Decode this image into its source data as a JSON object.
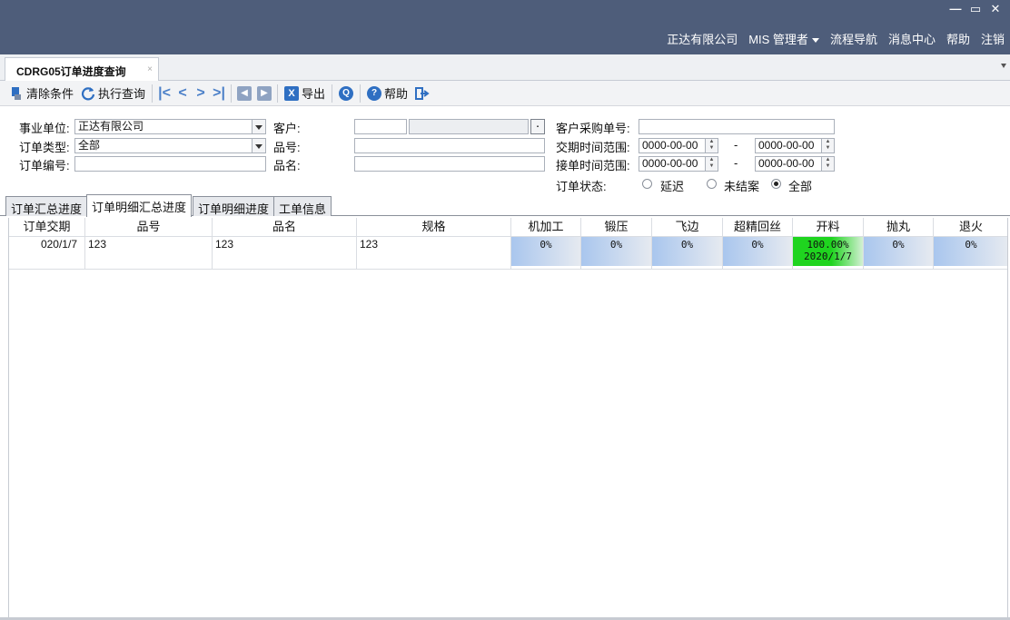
{
  "header": {
    "window_controls": {
      "minimize": "—",
      "restore": "▭",
      "close": "✕"
    },
    "nav": {
      "company": "正达有限公司",
      "user": "MIS 管理者",
      "flow_nav": "流程导航",
      "messages": "消息中心",
      "help": "帮助",
      "logout": "注销"
    }
  },
  "doc_tab": {
    "title": "CDRG05订单进度查询",
    "close": "×"
  },
  "toolbar": {
    "clear": "清除条件",
    "execute": "执行查询",
    "first": "|<",
    "prev": "<",
    "next": ">",
    "last": ">|",
    "export": "导出",
    "help": "帮助"
  },
  "form": {
    "business_unit_label": "事业单位:",
    "business_unit_value": "正达有限公司",
    "order_type_label": "订单类型:",
    "order_type_value": "全部",
    "order_no_label": "订单编号:",
    "order_no_value": "",
    "customer_label": "客户:",
    "customer_code": "",
    "customer_name": "",
    "item_no_label": "品号:",
    "item_no_value": "",
    "item_name_label": "品名:",
    "item_name_value": "",
    "po_label": "客户采购单号:",
    "po_value": "",
    "delivery_range_label": "交期时间范围:",
    "delivery_from": "0000-00-00",
    "delivery_to": "0000-00-00",
    "receive_range_label": "接单时间范围:",
    "receive_from": "0000-00-00",
    "receive_to": "0000-00-00",
    "range_dash": "-",
    "status_label": "订单状态:",
    "status_options": [
      "延迟",
      "未结案",
      "全部"
    ],
    "status_selected": "全部"
  },
  "sub_tabs": [
    "订单汇总进度",
    "订单明细汇总进度",
    "订单明细进度",
    "工单信息"
  ],
  "active_sub_tab": "订单明细汇总进度",
  "grid": {
    "columns": [
      "订单交期",
      "品号",
      "品名",
      "规格",
      "机加工",
      "锻压",
      "飞边",
      "超精回丝",
      "开料",
      "抛丸",
      "退火"
    ],
    "rows": [
      {
        "due": "020/1/7",
        "item_no": "123",
        "item_name": "123",
        "spec": "123",
        "processes": [
          {
            "pct": "0%",
            "date": "",
            "progress": 0
          },
          {
            "pct": "0%",
            "date": "",
            "progress": 0
          },
          {
            "pct": "0%",
            "date": "",
            "progress": 0
          },
          {
            "pct": "0%",
            "date": "",
            "progress": 0
          },
          {
            "pct": "100.00%",
            "date": "2020/1/7",
            "progress": 1.0
          },
          {
            "pct": "0%",
            "date": "",
            "progress": 0
          },
          {
            "pct": "0%",
            "date": "",
            "progress": 0
          }
        ]
      }
    ]
  },
  "colors": {
    "header_bg": "#4e5d7a",
    "progress_zero_start": "#a9c6ee",
    "progress_zero_end": "#e6eaf0",
    "progress_done_start": "#1fd41f",
    "progress_done_end": "#d3f0d3"
  }
}
